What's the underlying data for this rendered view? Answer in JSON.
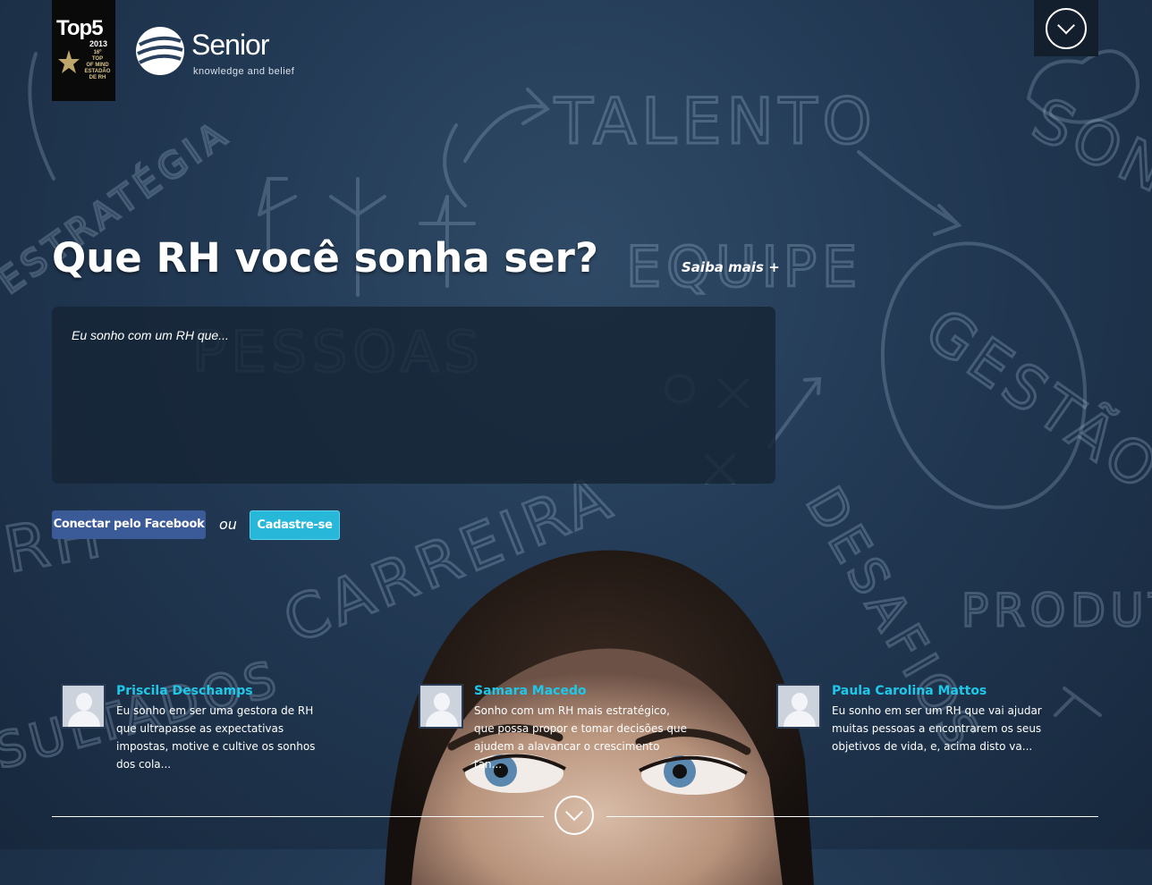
{
  "brand": {
    "badge_title": "Top5",
    "badge_year": "2013",
    "badge_lines": [
      "16º",
      "TOP",
      "OF MIND",
      "ESTADÃO",
      "DE RH"
    ],
    "name": "Senior",
    "tagline": "knowledge and belief"
  },
  "background_words": [
    "TALENTO",
    "EQUIPE",
    "PESSOAS",
    "CARREIRA",
    "GESTÃO",
    "SONHO",
    "ESTRATÉGIA",
    "DESAFIOS",
    "PRODUTI",
    "RH",
    "SULTADOS"
  ],
  "hero": {
    "title": "Que RH você sonha ser?",
    "learn_more": "Saiba mais +",
    "input_placeholder": "Eu sonho com um RH que..."
  },
  "actions": {
    "facebook": "Conectar pelo Facebook",
    "or": "ou",
    "register": "Cadastre-se"
  },
  "dreams": [
    {
      "name": "Priscila Deschamps",
      "text": "Eu sonho em ser uma gestora de RH que ultrapasse as expectativas impostas, motive e cultive os sonhos dos cola..."
    },
    {
      "name": "Samara Macedo",
      "text": "Sonho com um RH mais estratégico, que possa propor e tomar decisões que ajudem a alavancar o crescimento tan..."
    },
    {
      "name": "Paula Carolina Mattos",
      "text": "Eu sonho em ser um RH que vai ajudar muitas pessoas a encontrarem os seus objetivos de vida, e, acima disto va..."
    }
  ],
  "colors": {
    "accent": "#1ec8ea",
    "facebook": "#3a5a98",
    "register": "#27b8d9"
  }
}
